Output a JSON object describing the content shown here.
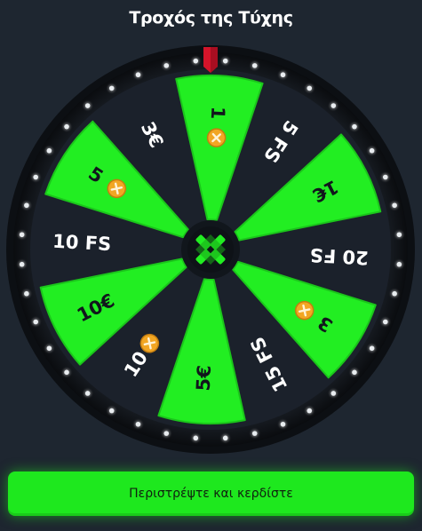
{
  "title": "Τροχός της Τύχης",
  "spin_button_label": "Περιστρέψτε και κερδίστε",
  "colors": {
    "background": "#1e2630",
    "wheel_rim": "#0c0f13",
    "segment_green": "#22ee22",
    "segment_dark": "#1b212b",
    "pointer": "#d4142a",
    "coin": "#f2a623",
    "button": "#1ee81e"
  },
  "segments": [
    {
      "label": "1",
      "type": "green",
      "coin": true
    },
    {
      "label": "5 FS",
      "type": "dark",
      "coin": false
    },
    {
      "label": "1€",
      "type": "green",
      "coin": false
    },
    {
      "label": "20 FS",
      "type": "dark",
      "coin": false
    },
    {
      "label": "3",
      "type": "green",
      "coin": true
    },
    {
      "label": "15 FS",
      "type": "dark",
      "coin": false
    },
    {
      "label": "5€",
      "type": "green",
      "coin": false
    },
    {
      "label": "10",
      "type": "dark",
      "coin": true
    },
    {
      "label": "10€",
      "type": "green",
      "coin": false
    },
    {
      "label": "10 FS",
      "type": "dark",
      "coin": false
    },
    {
      "label": "5",
      "type": "green",
      "coin": true
    },
    {
      "label": "3€",
      "type": "dark",
      "coin": false
    }
  ],
  "icons": {
    "pointer": "pointer-icon",
    "hub": "brand-logo-icon",
    "coin": "coin-icon"
  }
}
